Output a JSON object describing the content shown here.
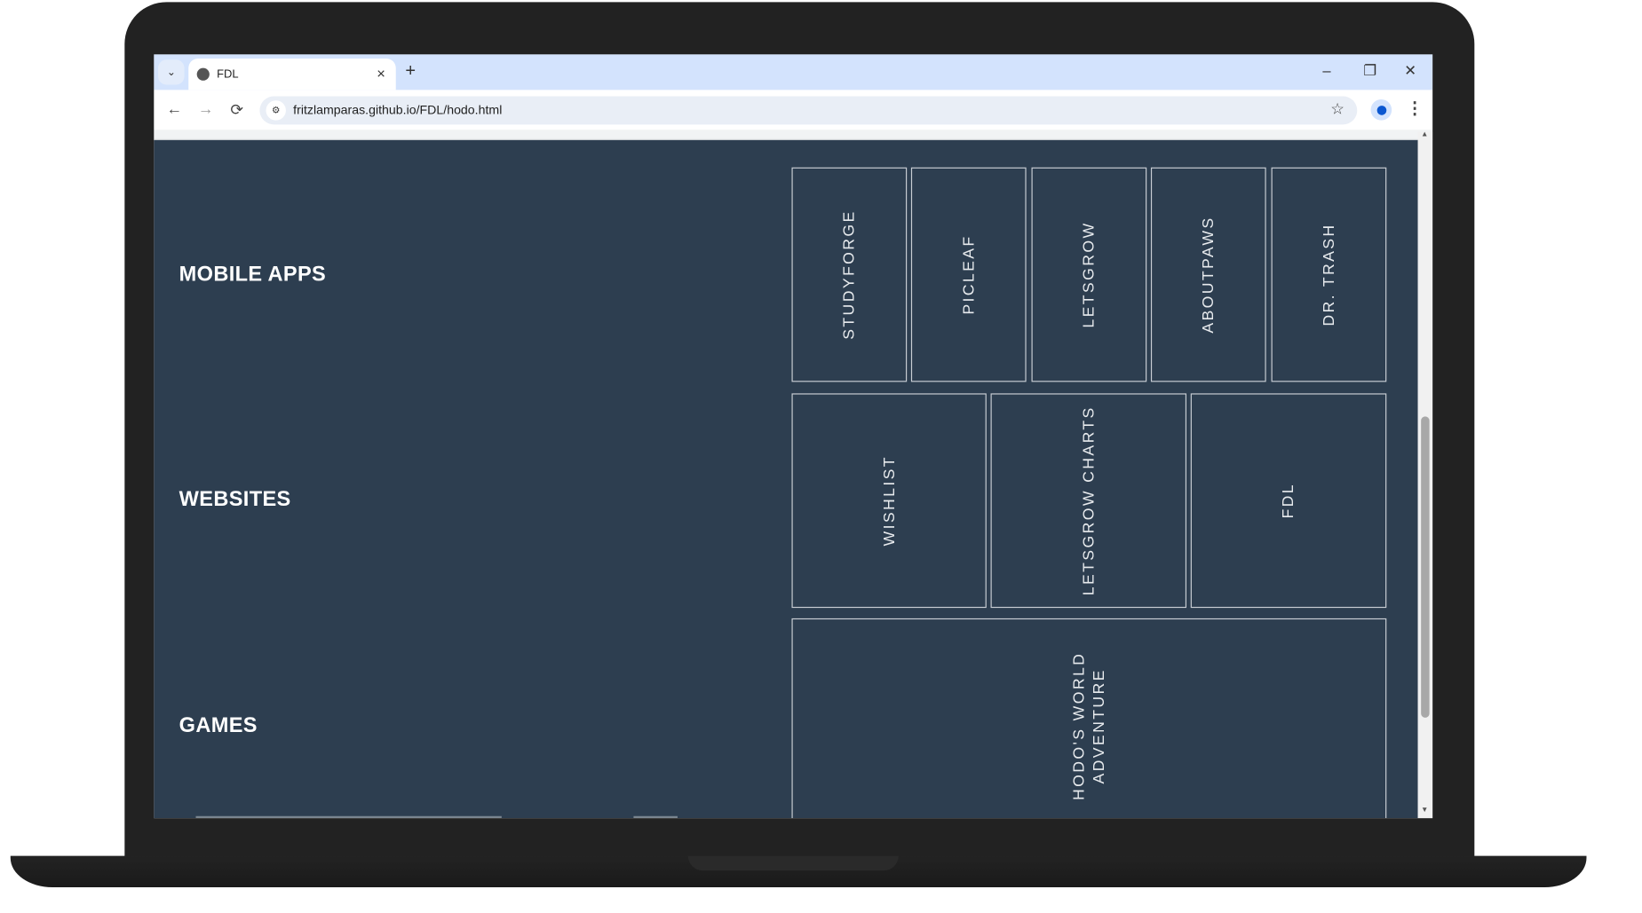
{
  "browser": {
    "tab_title": "FDL",
    "url": "fritzlamparas.github.io/FDL/hodo.html",
    "new_tab": "+",
    "tab_close": "×",
    "minimize": "–",
    "restore": "❐",
    "close": "✕",
    "back": "←",
    "forward": "→",
    "reload": "⟳",
    "star": "☆",
    "menu": "⋮",
    "dropdown": "⌄",
    "site_settings": "⚙"
  },
  "page": {
    "sections": [
      {
        "title": "MOBILE APPS",
        "items": [
          "STUDYFORGE",
          "PICLEAF",
          "LETSGROW",
          "ABOUTPAWS",
          "DR. TRASH"
        ]
      },
      {
        "title": "WEBSITES",
        "items": [
          "WISHLIST",
          "LETSGROW CHARTS",
          "FDL"
        ]
      },
      {
        "title": "GAMES",
        "items": [
          "HODO'S WORLD ADVENTURE"
        ]
      }
    ]
  },
  "colors": {
    "page_bg": "#2d3e50",
    "tabstrip": "#d3e3fd"
  }
}
